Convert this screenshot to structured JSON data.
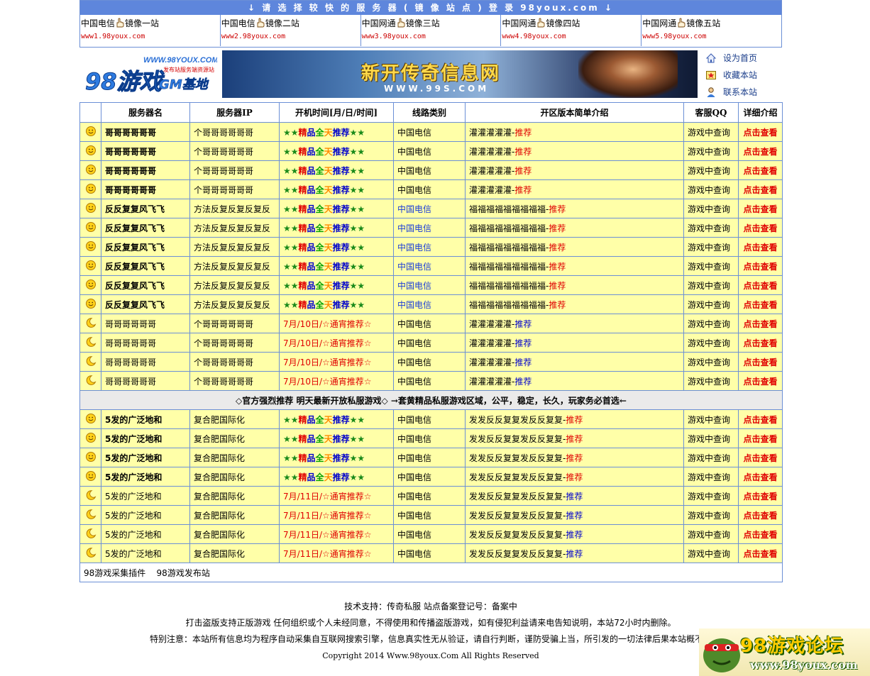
{
  "mirror": {
    "heading": "↓ 请 选 择 较 快 的 服 务 器 ( 镜 像 站 点 ) 登 录 98youx.com ↓",
    "sites": [
      {
        "isp": "中国电信",
        "name": "镜像一站",
        "url": "www1.98youx.com"
      },
      {
        "isp": "中国电信",
        "name": "镜像二站",
        "url": "www2.98youx.com"
      },
      {
        "isp": "中国网通",
        "name": "镜像三站",
        "url": "www3.98youx.com"
      },
      {
        "isp": "中国网通",
        "name": "镜像四站",
        "url": "www4.98youx.com"
      },
      {
        "isp": "中国网通",
        "name": "镜像五站",
        "url": "www5.98youx.com"
      }
    ]
  },
  "logo": {
    "url_text": "WWW.98YOUX.COM",
    "sub": "发布站服务端资源站",
    "main": "98游戏",
    "gm": "GM基地"
  },
  "banner": {
    "title": "新开传奇信息网",
    "url": "WWW.99S.COM"
  },
  "side_links": [
    {
      "label": "设为首页",
      "icon": "home-icon"
    },
    {
      "label": "收藏本站",
      "icon": "bookmark-icon"
    },
    {
      "label": "联系本站",
      "icon": "contact-icon"
    }
  ],
  "table": {
    "headers": [
      "服务器名",
      "服务器IP",
      "开机时间[月/日/时间]",
      "线路类别",
      "开区版本简单介绍",
      "客服QQ",
      "详细介绍"
    ],
    "rows_a": [
      {
        "mood": "smile",
        "name": "哥哥哥哥哥哥",
        "bold": true,
        "ip": "个哥哥哥哥哥哥",
        "time": "rec",
        "line": "中国电信",
        "lineBlue": false,
        "intro": "灌灌灌灌灌-",
        "tag": "推荐",
        "tagColor": "r",
        "qq": "游戏中查询",
        "detail": "点击查看"
      },
      {
        "mood": "smile",
        "name": "哥哥哥哥哥哥",
        "bold": true,
        "ip": "个哥哥哥哥哥哥",
        "time": "rec",
        "line": "中国电信",
        "lineBlue": false,
        "intro": "灌灌灌灌灌-",
        "tag": "推荐",
        "tagColor": "r",
        "qq": "游戏中查询",
        "detail": "点击查看"
      },
      {
        "mood": "smile",
        "name": "哥哥哥哥哥哥",
        "bold": true,
        "ip": "个哥哥哥哥哥哥",
        "time": "rec",
        "line": "中国电信",
        "lineBlue": false,
        "intro": "灌灌灌灌灌-",
        "tag": "推荐",
        "tagColor": "r",
        "qq": "游戏中查询",
        "detail": "点击查看"
      },
      {
        "mood": "smile",
        "name": "哥哥哥哥哥哥",
        "bold": true,
        "ip": "个哥哥哥哥哥哥",
        "time": "rec",
        "line": "中国电信",
        "lineBlue": false,
        "intro": "灌灌灌灌灌-",
        "tag": "推荐",
        "tagColor": "r",
        "qq": "游戏中查询",
        "detail": "点击查看"
      },
      {
        "mood": "smile",
        "name": "反反复复风飞飞",
        "bold": true,
        "ip": "方法反复反复反复反",
        "time": "rec",
        "line": "中国电信",
        "lineBlue": true,
        "intro": "福福福福福福福福福-",
        "tag": "推荐",
        "tagColor": "r",
        "qq": "游戏中查询",
        "detail": "点击查看"
      },
      {
        "mood": "smile",
        "name": "反反复复风飞飞",
        "bold": true,
        "ip": "方法反复反复反复反",
        "time": "rec",
        "line": "中国电信",
        "lineBlue": true,
        "intro": "福福福福福福福福福-",
        "tag": "推荐",
        "tagColor": "r",
        "qq": "游戏中查询",
        "detail": "点击查看"
      },
      {
        "mood": "smile",
        "name": "反反复复风飞飞",
        "bold": true,
        "ip": "方法反复反复反复反",
        "time": "rec",
        "line": "中国电信",
        "lineBlue": true,
        "intro": "福福福福福福福福福-",
        "tag": "推荐",
        "tagColor": "r",
        "qq": "游戏中查询",
        "detail": "点击查看"
      },
      {
        "mood": "smile",
        "name": "反反复复风飞飞",
        "bold": true,
        "ip": "方法反复反复反复反",
        "time": "rec",
        "line": "中国电信",
        "lineBlue": true,
        "intro": "福福福福福福福福福-",
        "tag": "推荐",
        "tagColor": "r",
        "qq": "游戏中查询",
        "detail": "点击查看"
      },
      {
        "mood": "smile",
        "name": "反反复复风飞飞",
        "bold": true,
        "ip": "方法反复反复反复反",
        "time": "rec",
        "line": "中国电信",
        "lineBlue": true,
        "intro": "福福福福福福福福福-",
        "tag": "推荐",
        "tagColor": "r",
        "qq": "游戏中查询",
        "detail": "点击查看"
      },
      {
        "mood": "smile",
        "name": "反反复复风飞飞",
        "bold": true,
        "ip": "方法反复反复反复反",
        "time": "rec",
        "line": "中国电信",
        "lineBlue": true,
        "intro": "福福福福福福福福福-",
        "tag": "推荐",
        "tagColor": "r",
        "qq": "游戏中查询",
        "detail": "点击查看"
      },
      {
        "mood": "moon",
        "name": "哥哥哥哥哥哥",
        "bold": false,
        "ip": "个哥哥哥哥哥哥",
        "time": "7月/10日/☆通宵推荐☆",
        "line": "中国电信",
        "lineBlue": false,
        "intro": "灌灌灌灌灌-",
        "tag": "推荐",
        "tagColor": "b",
        "qq": "游戏中查询",
        "detail": "点击查看"
      },
      {
        "mood": "moon",
        "name": "哥哥哥哥哥哥",
        "bold": false,
        "ip": "个哥哥哥哥哥哥",
        "time": "7月/10日/☆通宵推荐☆",
        "line": "中国电信",
        "lineBlue": false,
        "intro": "灌灌灌灌灌-",
        "tag": "推荐",
        "tagColor": "b",
        "qq": "游戏中查询",
        "detail": "点击查看"
      },
      {
        "mood": "moon",
        "name": "哥哥哥哥哥哥",
        "bold": false,
        "ip": "个哥哥哥哥哥哥",
        "time": "7月/10日/☆通宵推荐☆",
        "line": "中国电信",
        "lineBlue": false,
        "intro": "灌灌灌灌灌-",
        "tag": "推荐",
        "tagColor": "b",
        "qq": "游戏中查询",
        "detail": "点击查看"
      },
      {
        "mood": "moon",
        "name": "哥哥哥哥哥哥",
        "bold": false,
        "ip": "个哥哥哥哥哥哥",
        "time": "7月/10日/☆通宵推荐☆",
        "line": "中国电信",
        "lineBlue": false,
        "intro": "灌灌灌灌灌-",
        "tag": "推荐",
        "tagColor": "b",
        "qq": "游戏中查询",
        "detail": "点击查看"
      }
    ],
    "separator": "◇官方强烈推荐 明天最新开放私服游戏◇ →套黄精品私服游戏区域，公平，稳定，长久，玩家务必首选←",
    "rows_b": [
      {
        "mood": "smile",
        "name": "5发的广泛地和",
        "bold": true,
        "ip": "复合肥国际化",
        "time": "rec",
        "line": "中国电信",
        "lineBlue": false,
        "intro": "发发反反复复发反反复复-",
        "tag": "推荐",
        "tagColor": "r",
        "qq": "游戏中查询",
        "detail": "点击查看"
      },
      {
        "mood": "smile",
        "name": "5发的广泛地和",
        "bold": true,
        "ip": "复合肥国际化",
        "time": "rec",
        "line": "中国电信",
        "lineBlue": false,
        "intro": "发发反反复复发反反复复-",
        "tag": "推荐",
        "tagColor": "r",
        "qq": "游戏中查询",
        "detail": "点击查看"
      },
      {
        "mood": "smile",
        "name": "5发的广泛地和",
        "bold": true,
        "ip": "复合肥国际化",
        "time": "rec",
        "line": "中国电信",
        "lineBlue": false,
        "intro": "发发反反复复发反反复复-",
        "tag": "推荐",
        "tagColor": "r",
        "qq": "游戏中查询",
        "detail": "点击查看"
      },
      {
        "mood": "smile",
        "name": "5发的广泛地和",
        "bold": true,
        "ip": "复合肥国际化",
        "time": "rec",
        "line": "中国电信",
        "lineBlue": false,
        "intro": "发发反反复复发反反复复-",
        "tag": "推荐",
        "tagColor": "r",
        "qq": "游戏中查询",
        "detail": "点击查看"
      },
      {
        "mood": "moon",
        "name": "5发的广泛地和",
        "bold": false,
        "ip": "复合肥国际化",
        "time": "7月/11日/☆通宵推荐☆",
        "line": "中国电信",
        "lineBlue": false,
        "intro": "发发反反复复发反反复复-",
        "tag": "推荐",
        "tagColor": "b",
        "qq": "游戏中查询",
        "detail": "点击查看"
      },
      {
        "mood": "moon",
        "name": "5发的广泛地和",
        "bold": false,
        "ip": "复合肥国际化",
        "time": "7月/11日/☆通宵推荐☆",
        "line": "中国电信",
        "lineBlue": false,
        "intro": "发发反反复复发反反复复-",
        "tag": "推荐",
        "tagColor": "b",
        "qq": "游戏中查询",
        "detail": "点击查看"
      },
      {
        "mood": "moon",
        "name": "5发的广泛地和",
        "bold": false,
        "ip": "复合肥国际化",
        "time": "7月/11日/☆通宵推荐☆",
        "line": "中国电信",
        "lineBlue": false,
        "intro": "发发反反复复发反反复复-",
        "tag": "推荐",
        "tagColor": "b",
        "qq": "游戏中查询",
        "detail": "点击查看"
      },
      {
        "mood": "moon",
        "name": "5发的广泛地和",
        "bold": false,
        "ip": "复合肥国际化",
        "time": "7月/11日/☆通宵推荐☆",
        "line": "中国电信",
        "lineBlue": false,
        "intro": "发发反反复复发反反复复-",
        "tag": "推荐",
        "tagColor": "b",
        "qq": "游戏中查询",
        "detail": "点击查看"
      }
    ],
    "rec_parts": [
      "★★",
      "精",
      "品",
      "全",
      "天",
      "推荐",
      "★★"
    ],
    "footer_links": [
      "98游戏采集插件",
      "98游戏发布站"
    ]
  },
  "footer": {
    "line1": "技术支持：传奇私服 站点备案登记号：备案中",
    "line2": "打击盗版支持正版游戏 任何组织或个人未经同意，不得使用和传播盗版游戏，如有侵犯利益请来电告知说明，本站72小时内删除。",
    "line3": "特别注意：本站所有信息均为程序自动采集自互联网搜索引擎，信息真实性无从验证，请自行判断，谨防受骗上当，所引发的一切法律后果本站概不负",
    "copyright": "Copyright 2014 Www.98youx.Com All Rights Reserved"
  },
  "forum": {
    "title": "98游戏论坛",
    "url": "www.98youx.com"
  },
  "colors": {
    "border": "#6b8fd6",
    "header_bar": "#5e86dc",
    "row_bg": "#ffffa8",
    "separator_bg": "#eaeaea",
    "detail_red": "#e00000"
  }
}
